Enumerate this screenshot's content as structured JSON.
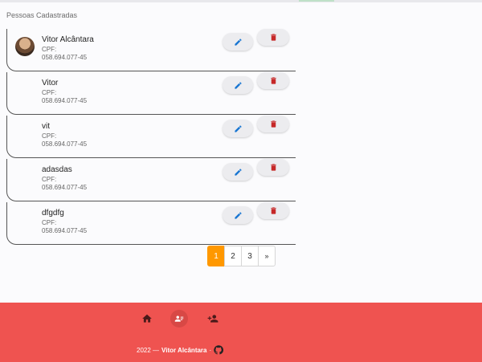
{
  "section_title": "Pessoas Cadastradas",
  "people": [
    {
      "name": "Vitor Alcântara",
      "cpf_label": "CPF:",
      "cpf": "058.694.077-45",
      "has_avatar": true
    },
    {
      "name": "Vitor",
      "cpf_label": "CPF:",
      "cpf": "058.694.077-45",
      "has_avatar": false
    },
    {
      "name": "vit",
      "cpf_label": "CPF:",
      "cpf": "058.694.077-45",
      "has_avatar": false
    },
    {
      "name": "adasdas",
      "cpf_label": "CPF:",
      "cpf": "058.694.077-45",
      "has_avatar": false
    },
    {
      "name": "dfgdfg",
      "cpf_label": "CPF:",
      "cpf": "058.694.077-45",
      "has_avatar": false
    }
  ],
  "actions": {
    "edit_icon": "pencil-icon",
    "delete_icon": "trash-icon",
    "edit_color": "#1976d2",
    "delete_color": "#c62828"
  },
  "pagination": {
    "pages": [
      "1",
      "2",
      "3"
    ],
    "next": "»",
    "active": "1",
    "active_color": "#ff9800"
  },
  "footer": {
    "background": "#ef5350",
    "nav": [
      {
        "icon": "home-icon"
      },
      {
        "icon": "contacts-icon",
        "active": true
      },
      {
        "icon": "person-add-icon"
      }
    ],
    "year": "2022 —",
    "author": "Vitor Alcântara",
    "separator": "·",
    "github_icon": "github-icon"
  }
}
